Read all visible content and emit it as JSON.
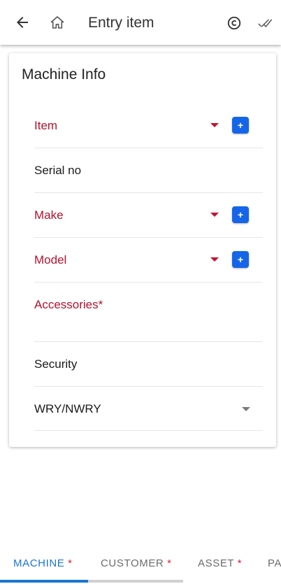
{
  "appbar": {
    "title": "Entry item",
    "icons": {
      "back": "arrow-back-icon",
      "home": "home-icon",
      "copy": "copyright-icon",
      "check": "done-all-icon"
    }
  },
  "card": {
    "title": "Machine Info",
    "fields": {
      "item": "Item",
      "serial": "Serial no",
      "make": "Make",
      "model": "Model",
      "accessories": "Accessories*",
      "security": "Security",
      "warranty": "WRY/NWRY"
    },
    "add_label": "+"
  },
  "tabs": {
    "machine": "MACHINE",
    "customer": "CUSTOMER",
    "asset": "ASSET",
    "partial": "PA",
    "required_mark": "*"
  },
  "colors": {
    "required": "#b3122d",
    "accent": "#1565e8",
    "tab_active": "#1976d2"
  }
}
